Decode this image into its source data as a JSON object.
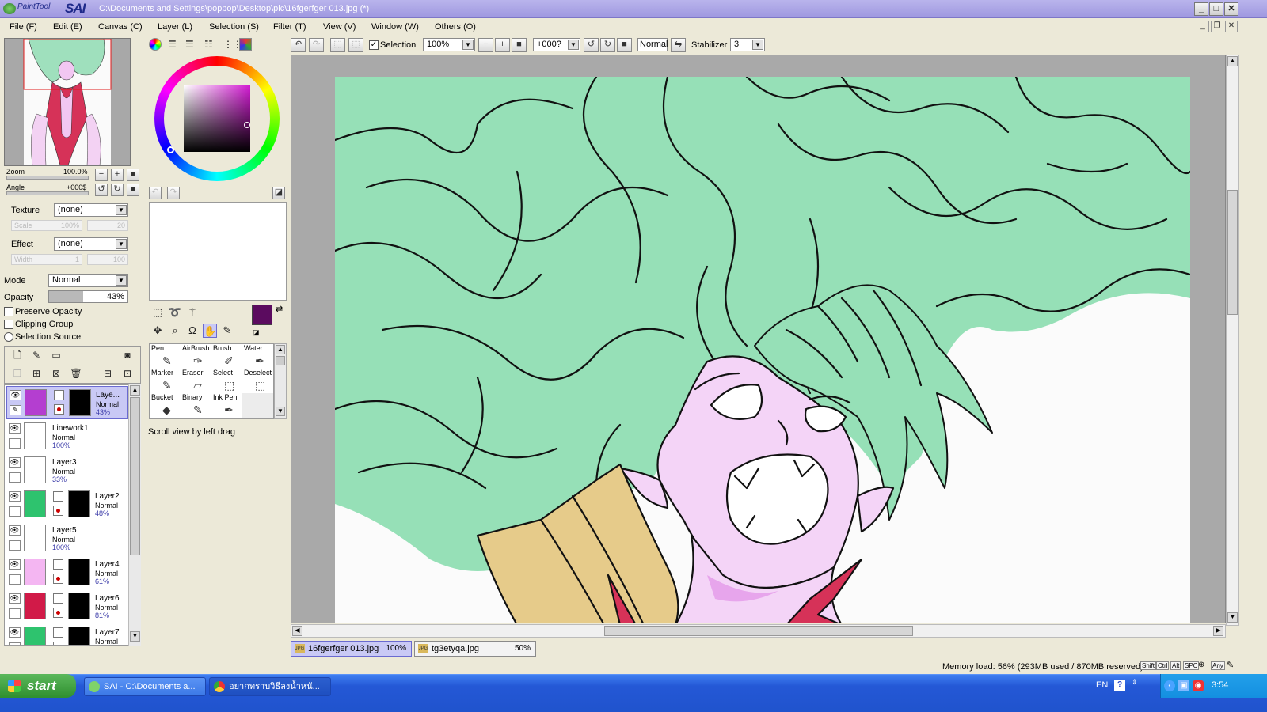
{
  "window": {
    "app_name_small": "PaintTool",
    "app_name_big": "SAI",
    "title": "C:\\Documents and Settings\\poppop\\Desktop\\pic\\16fgerfger 013.jpg (*)"
  },
  "menu": [
    "File (F)",
    "Edit (E)",
    "Canvas (C)",
    "Layer (L)",
    "Selection (S)",
    "Filter (T)",
    "View (V)",
    "Window (W)",
    "Others (O)"
  ],
  "navigator": {
    "zoom_label": "Zoom",
    "zoom_value": "100.0%",
    "angle_label": "Angle",
    "angle_value": "+000$"
  },
  "brush_props": {
    "texture_label": "Texture",
    "texture_value": "(none)",
    "scale_label": "Scale",
    "scale_value": "100%",
    "scale_num": "20",
    "effect_label": "Effect",
    "effect_value": "(none)",
    "width_label": "Width",
    "width_value": "1",
    "width_num": "100"
  },
  "layer_props": {
    "mode_label": "Mode",
    "mode_value": "Normal",
    "opacity_label": "Opacity",
    "opacity_value": "43%",
    "opacity_fraction": 0.43,
    "preserve_opacity": "Preserve Opacity",
    "clipping_group": "Clipping Group",
    "selection_source": "Selection Source"
  },
  "layers": [
    {
      "name": "Laye...",
      "mode": "Normal",
      "opacity": "43%",
      "color": "#b43ed0",
      "selected": true,
      "mask": true
    },
    {
      "name": "Linework1",
      "mode": "Normal",
      "opacity": "100%",
      "color": "#ffffff",
      "selected": false,
      "mask": false
    },
    {
      "name": "Layer3",
      "mode": "Normal",
      "opacity": "33%",
      "color": "#ffffff",
      "selected": false,
      "mask": false
    },
    {
      "name": "Layer2",
      "mode": "Normal",
      "opacity": "48%",
      "color": "#2ec36e",
      "selected": false,
      "mask": true
    },
    {
      "name": "Layer5",
      "mode": "Normal",
      "opacity": "100%",
      "color": "#ffffff",
      "selected": false,
      "mask": false
    },
    {
      "name": "Layer4",
      "mode": "Normal",
      "opacity": "61%",
      "color": "#f4b6f2",
      "selected": false,
      "mask": true
    },
    {
      "name": "Layer6",
      "mode": "Normal",
      "opacity": "81%",
      "color": "#d11a48",
      "selected": false,
      "mask": true
    },
    {
      "name": "Layer7",
      "mode": "Normal",
      "opacity": "",
      "color": "#2ec36e",
      "selected": false,
      "mask": true
    }
  ],
  "tools": {
    "primary_color": "#5b0b5f",
    "secondary_color": "#ffffff",
    "grid": [
      {
        "label": "Pen",
        "icon": "✎"
      },
      {
        "label": "AirBrush",
        "icon": "✑"
      },
      {
        "label": "Brush",
        "icon": "✐"
      },
      {
        "label": "Water",
        "icon": "✒"
      },
      {
        "label": "Marker",
        "icon": "✎"
      },
      {
        "label": "Eraser",
        "icon": "▱"
      },
      {
        "label": "Select",
        "icon": "⬚"
      },
      {
        "label": "Deselect",
        "icon": "⬚"
      },
      {
        "label": "Bucket",
        "icon": "◆"
      },
      {
        "label": "Binary",
        "icon": "✎"
      },
      {
        "label": "Ink Pen",
        "icon": "✒"
      },
      {
        "label": "",
        "icon": ""
      }
    ],
    "status_hint": "Scroll view by left drag"
  },
  "canvas_toolbar": {
    "selection_label": "Selection",
    "zoom_value": "100%",
    "angle_value": "+000?",
    "blend_value": "Normal",
    "stabilizer_label": "Stabilizer",
    "stabilizer_value": "3"
  },
  "documents": [
    {
      "name": "16fgerfger 013.jpg",
      "zoom": "100%",
      "active": true
    },
    {
      "name": "tg3etyqa.jpg",
      "zoom": "50%",
      "active": false
    }
  ],
  "status": {
    "memory": "Memory load: 56% (293MB used / 870MB reserved)",
    "keys": [
      "Shift",
      "Ctrl",
      "Alt",
      "SPC",
      "Any"
    ]
  },
  "taskbar": {
    "start": "start",
    "tasks": [
      "SAI - C:\\Documents a...",
      "อยากทราบวิธีลงน้ำหนั..."
    ],
    "lang": "EN",
    "clock": "3:54"
  },
  "colors": {
    "hair": "#96e0b7",
    "skin": "#f4d4f7",
    "collar": "#e6cb8a",
    "red": "#d63258",
    "title_bar": "#a9a2e6",
    "taskbar": "#2456d2"
  }
}
